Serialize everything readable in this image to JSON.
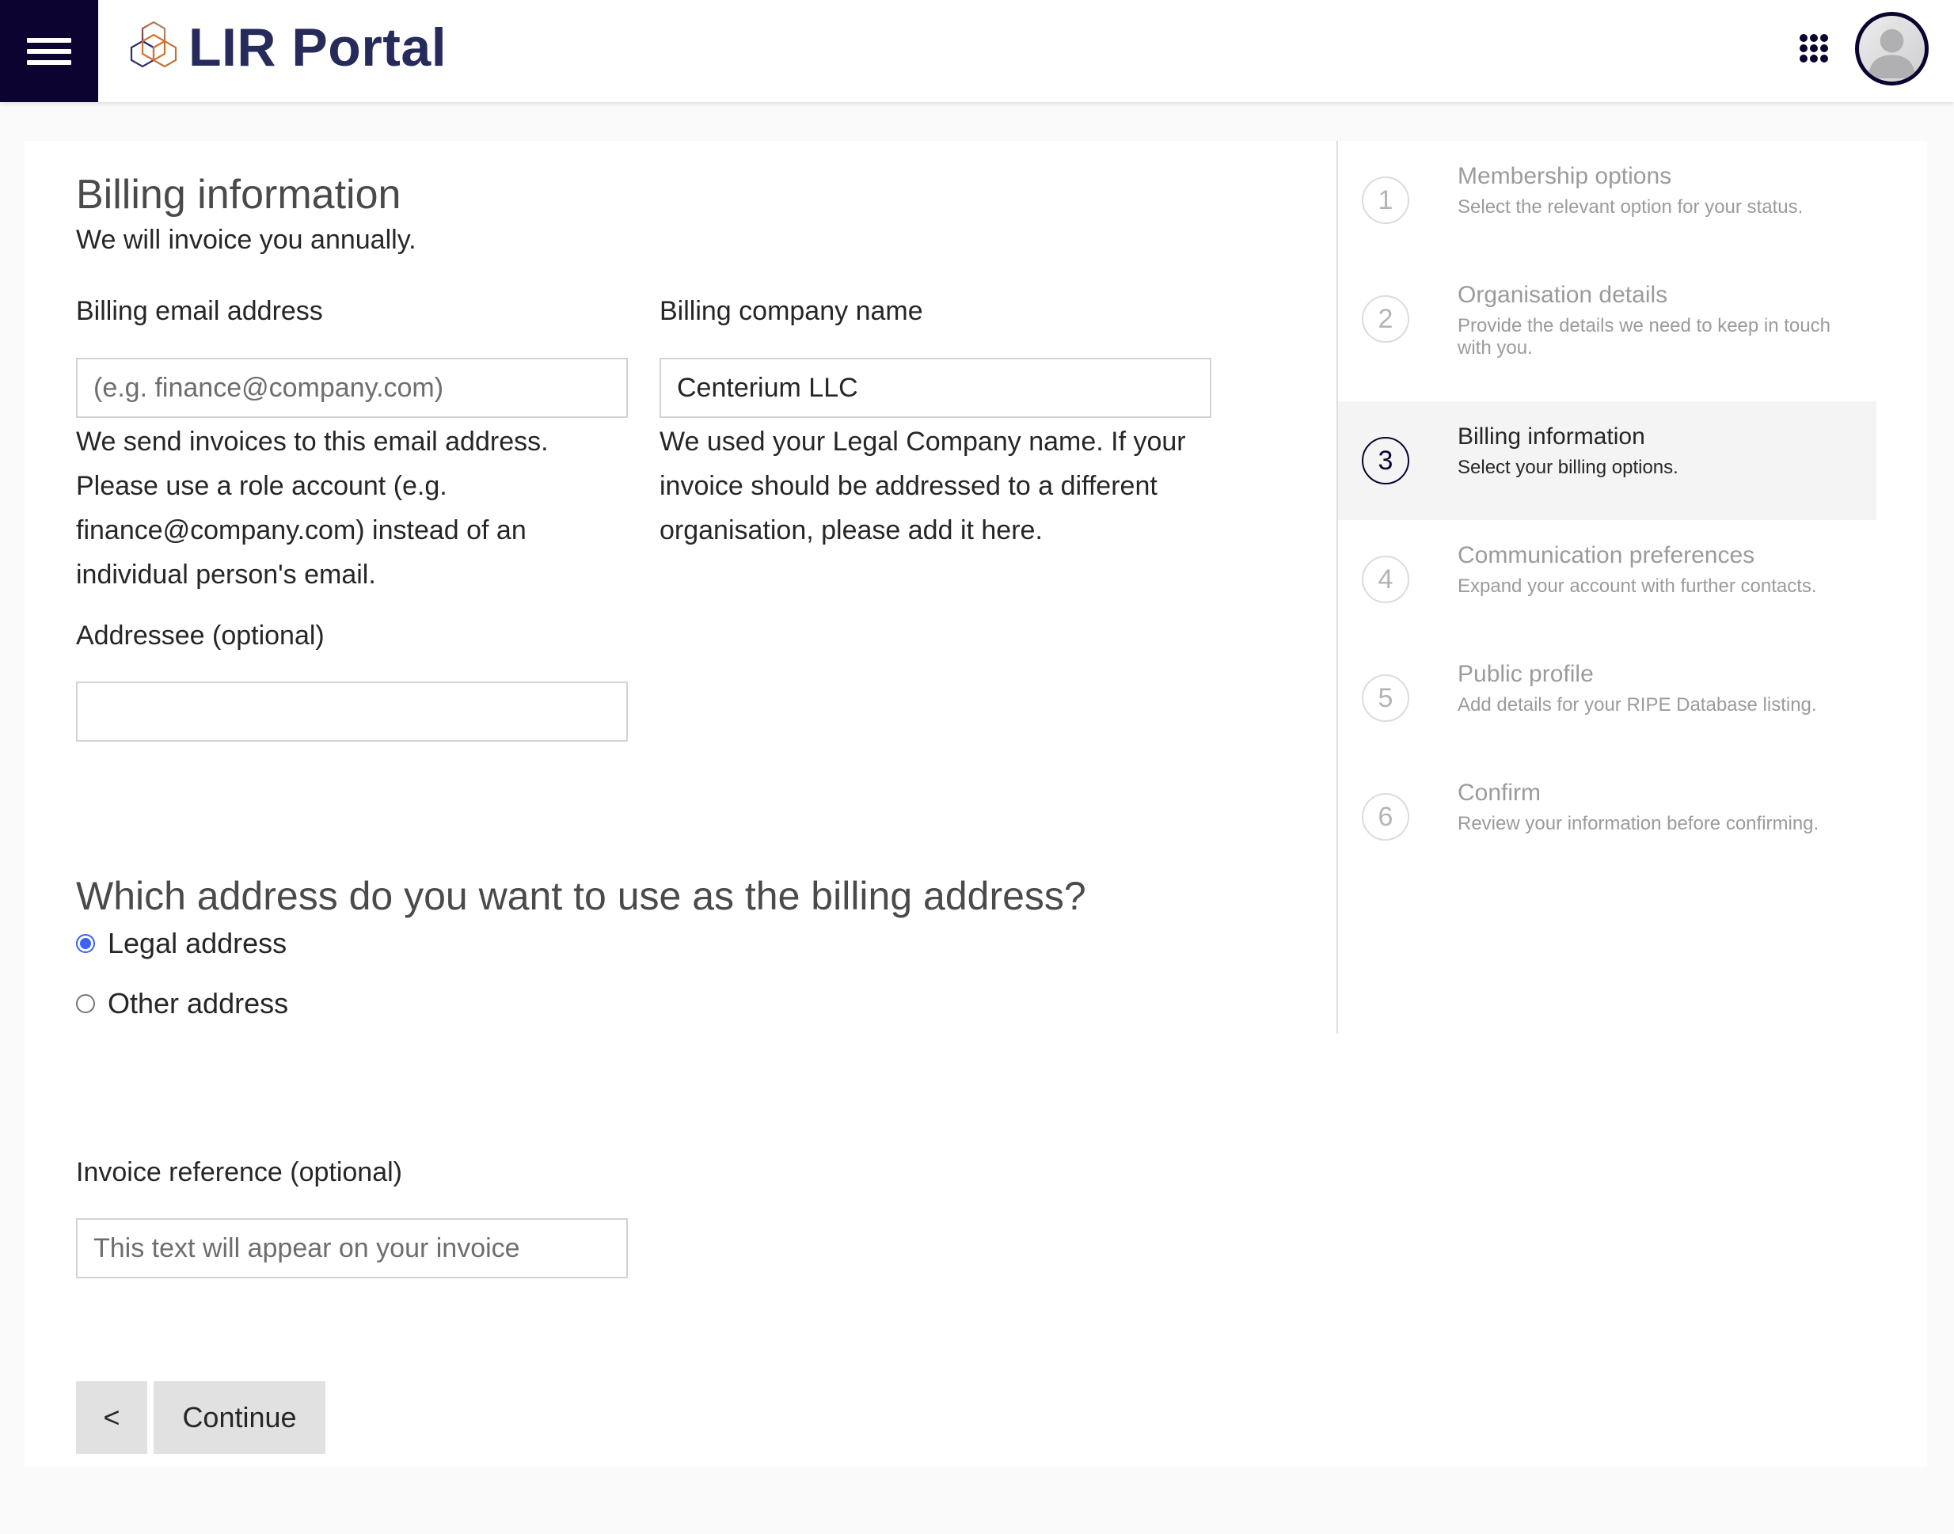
{
  "header": {
    "brand": "LIR Portal",
    "menu_icon": "hamburger-menu-icon",
    "apps_icon": "apps-grid-icon",
    "avatar_icon": "user-avatar-icon",
    "colors": {
      "nav_dark": "#0d0330",
      "brand_text": "#262b5c",
      "logo_orange": "#e07a2e"
    }
  },
  "form": {
    "title": "Billing information",
    "subtitle": "We will invoice you annually.",
    "billing_email": {
      "label": "Billing email address",
      "value": "",
      "placeholder": "(e.g. finance@company.com)",
      "help": "We send invoices to this email address. Please use a role account (e.g. finance@company.com) instead of an individual person's email."
    },
    "billing_company": {
      "label": "Billing company name",
      "value": "Centerium LLC",
      "placeholder": "",
      "help": "We used your Legal Company name. If your invoice should be addressed to a different organisation, please add it here."
    },
    "addressee": {
      "label": "Addressee (optional)",
      "value": "",
      "placeholder": ""
    },
    "address_question": "Which address do you want to use as the billing address?",
    "address_options": [
      {
        "label": "Legal address",
        "checked": true
      },
      {
        "label": "Other address",
        "checked": false
      }
    ],
    "invoice_reference": {
      "label": "Invoice reference (optional)",
      "value": "",
      "placeholder": "This text will appear on your invoice"
    },
    "back_label": "<",
    "continue_label": "Continue",
    "colors": {
      "radio_accent": "#3b63f7",
      "button_bg": "#e1e1e1"
    }
  },
  "stepper": {
    "current_step": 3,
    "steps": [
      {
        "number": "1",
        "title": "Membership options",
        "description": "Select the relevant option for your status."
      },
      {
        "number": "2",
        "title": "Organisation details",
        "description": "Provide the details we need to keep in touch with you."
      },
      {
        "number": "3",
        "title": "Billing information",
        "description": "Select your billing options."
      },
      {
        "number": "4",
        "title": "Communication preferences",
        "description": "Expand your account with further contacts."
      },
      {
        "number": "5",
        "title": "Public profile",
        "description": "Add details for your RIPE Database listing."
      },
      {
        "number": "6",
        "title": "Confirm",
        "description": "Review your information before confirming."
      }
    ]
  }
}
